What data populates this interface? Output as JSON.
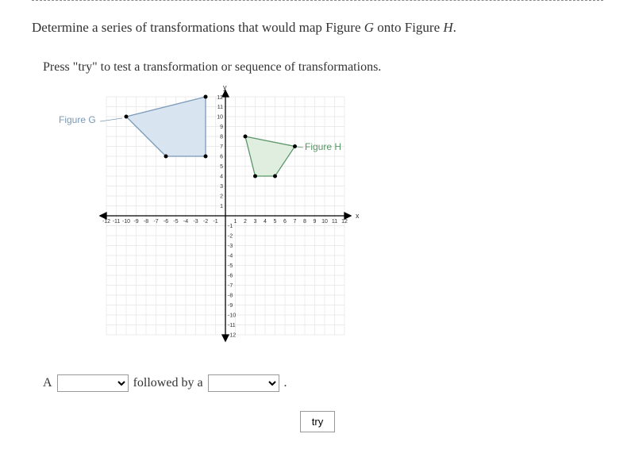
{
  "question": "Determine a series of transformations that would map Figure G onto Figure H.",
  "figure_g_name": "G",
  "figure_h_name": "H",
  "instruction": "Press \"try\" to test a transformation or sequence of transformations.",
  "figure_g_label": "Figure G",
  "figure_h_label": "Figure H",
  "answer": {
    "prefix": "A",
    "middle": "followed by a",
    "suffix": "."
  },
  "try_button": "try",
  "axis": {
    "x_label": "x",
    "y_label": "y",
    "x_ticks_neg": [
      "-12",
      "-11",
      "-10",
      "-9",
      "-8",
      "-7",
      "-6",
      "-5",
      "-4",
      "-3",
      "-2",
      "-1"
    ],
    "x_ticks_pos": [
      "1",
      "2",
      "3",
      "4",
      "5",
      "6",
      "7",
      "8",
      "9",
      "10",
      "11",
      "12"
    ],
    "y_ticks_pos": [
      "1",
      "2",
      "3",
      "4",
      "5",
      "6",
      "7",
      "8",
      "9",
      "10",
      "11",
      "12"
    ],
    "y_ticks_neg": [
      "-1",
      "-2",
      "-3",
      "-4",
      "-5",
      "-6",
      "-7",
      "-8",
      "-9",
      "-10",
      "-11",
      "-12"
    ]
  },
  "chart_data": {
    "type": "coordinate-plane",
    "xlim": [
      -12,
      12
    ],
    "ylim": [
      -12,
      12
    ],
    "figures": [
      {
        "name": "Figure G",
        "color": "#d8e4f0",
        "stroke": "#7a99b8",
        "points": [
          [
            -10,
            10
          ],
          [
            -2,
            12
          ],
          [
            -2,
            6
          ],
          [
            -6,
            6
          ]
        ]
      },
      {
        "name": "Figure H",
        "color": "#e0eee0",
        "stroke": "#5a9668",
        "points": [
          [
            2,
            8
          ],
          [
            7,
            7
          ],
          [
            5,
            4
          ],
          [
            3,
            4
          ]
        ]
      }
    ]
  }
}
